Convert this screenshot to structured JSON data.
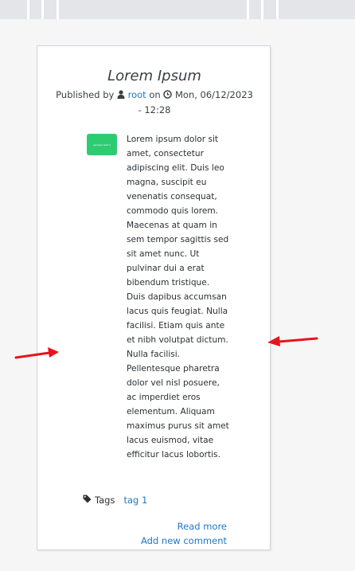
{
  "article": {
    "title": "Lorem Ipsum",
    "published_prefix": "Published by",
    "author": "root",
    "on_label": "on",
    "date": "Mon, 06/12/2023 - 12:28",
    "thumbnail_caption": "sample text 1",
    "body": "Lorem ipsum dolor sit amet, consectetur adipiscing elit. Duis leo magna, suscipit eu venenatis consequat, commodo quis lorem. Maecenas at quam in sem tempor sagittis sed sit amet nunc. Ut pulvinar dui a erat bibendum tristique. Duis dapibus accumsan lacus quis feugiat. Nulla facilisi. Etiam quis ante et nibh volutpat dictum. Nulla facilisi. Pellentesque pharetra dolor vel nisl posuere, ac imperdiet eros elementum. Aliquam maximus purus sit amet lacus euismod, vitae efficitur lacus lobortis.",
    "tags_label": "Tags",
    "tags": [
      "tag 1"
    ],
    "read_more": "Read more",
    "add_comment": "Add new comment"
  },
  "colors": {
    "link": "#1f77c9",
    "thumbnail": "#2ecc71",
    "annotation_arrow": "#e8141b",
    "page_background": "#f6f6f7",
    "top_bar": "#e3e5e8"
  },
  "icons": {
    "author": "user-icon",
    "date": "clock-icon",
    "tags": "tag-icon"
  }
}
